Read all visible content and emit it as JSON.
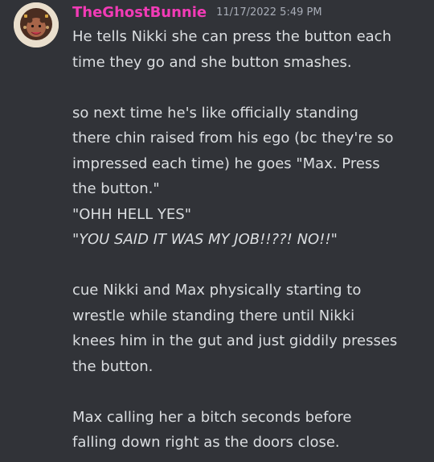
{
  "header": {
    "username": "TheGhostBunnie",
    "timestamp": "11/17/2022 5:49 PM"
  },
  "message": {
    "lines": [
      "He tells Nikki she can press the button each",
      "time they go and she button smashes.",
      "",
      " so next time he's like officially standing",
      "there chin raised from his ego (bc they're so",
      "impressed each time) he goes \"Max. Press",
      "the button.\"",
      "\"OHH HELL YES\"",
      "\"YOU SAID IT WAS MY JOB!!??!   NO!!\"",
      "",
      "cue Nikki and Max physically starting to",
      "wrestle while standing there until Nikki",
      "knees him in the gut and just giddily presses",
      "the button.",
      "",
      "Max calling her a bitch seconds before",
      "falling down right as the doors close."
    ]
  },
  "colors": {
    "background": "#313338",
    "username": "#f23bb6",
    "timestamp": "#a8adb7",
    "text": "#dbdee1"
  },
  "icons": {
    "avatar": "avatar-image"
  }
}
